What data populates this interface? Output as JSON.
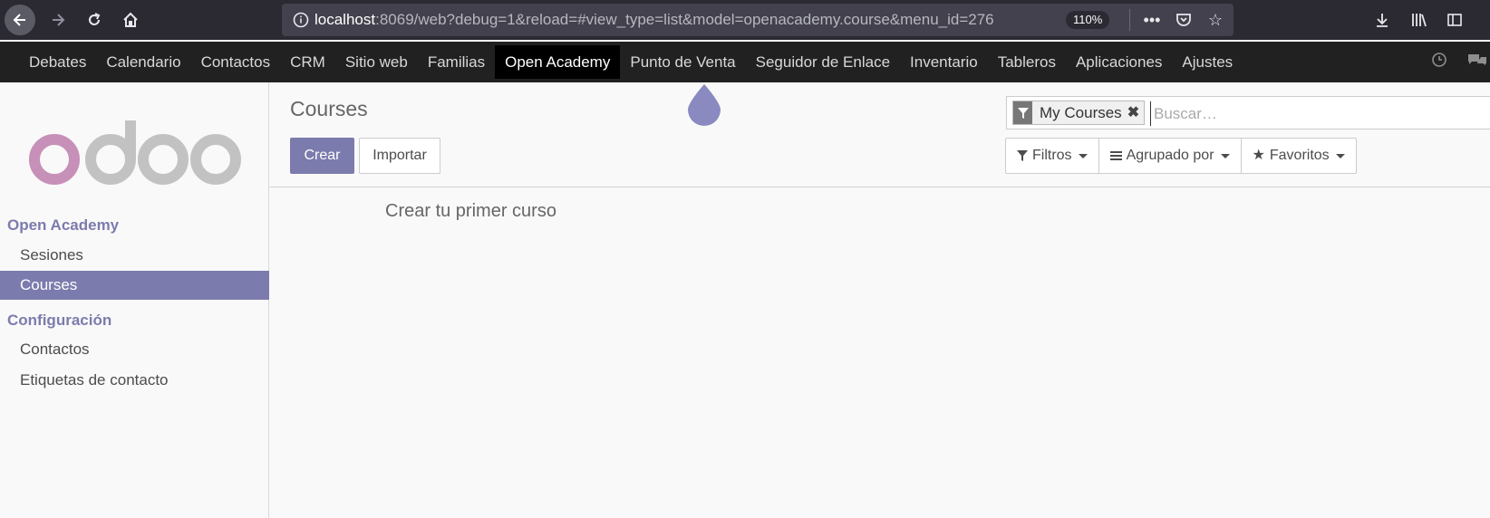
{
  "browser": {
    "url_host": "localhost",
    "url_rest": ":8069/web?debug=1&reload=#view_type=list&model=openacademy.course&menu_id=276",
    "zoom": "110%"
  },
  "topmenu": {
    "items": [
      "Debates",
      "Calendario",
      "Contactos",
      "CRM",
      "Sitio web",
      "Familias",
      "Open Academy",
      "Punto de Venta",
      "Seguidor de Enlace",
      "Inventario",
      "Tableros",
      "Aplicaciones",
      "Ajustes"
    ],
    "active": "Open Academy"
  },
  "sidebar": {
    "sections": [
      {
        "title": "Open Academy",
        "items": [
          "Sesiones",
          "Courses"
        ]
      },
      {
        "title": "Configuración",
        "items": [
          "Contactos",
          "Etiquetas de contacto"
        ]
      }
    ],
    "active_item": "Courses"
  },
  "control_panel": {
    "title": "Courses",
    "create_label": "Crear",
    "import_label": "Importar",
    "search_facet": "My Courses",
    "search_placeholder": "Buscar…",
    "filters_label": "Filtros",
    "groupby_label": "Agrupado por",
    "favorites_label": "Favoritos"
  },
  "view": {
    "empty_help": "Crear tu primer curso"
  },
  "colors": {
    "accent": "#7c7bad",
    "topbar": "#212121",
    "browser": "#2b2a33"
  }
}
